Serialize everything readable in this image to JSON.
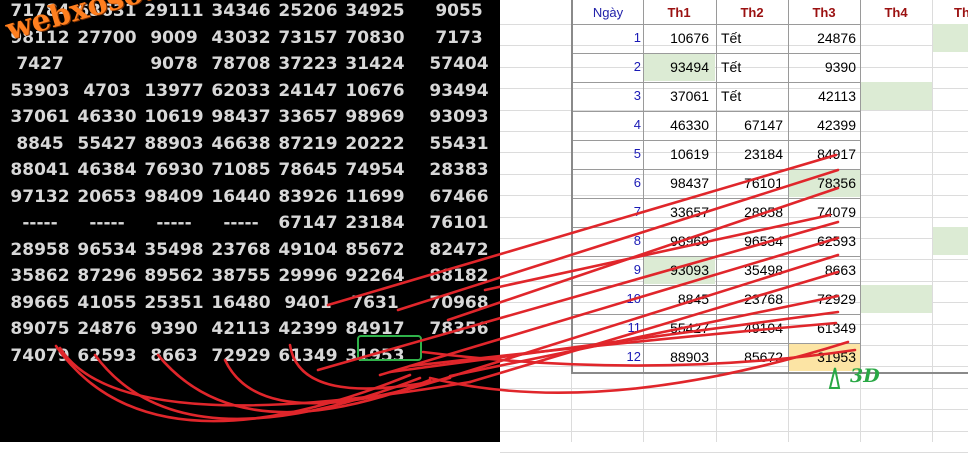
{
  "watermark": "webxoso.net",
  "number_grid": {
    "rows": [
      [
        "71784",
        "63631",
        "29111",
        "34346",
        "25206",
        "34925",
        "9055"
      ],
      [
        "98112",
        "27700",
        "9009",
        "43032",
        "73157",
        "70830",
        "7173"
      ],
      [
        "7427",
        "",
        "9078",
        "78708",
        "37223",
        "31424",
        "57404"
      ],
      [
        "53903",
        "4703",
        "13977",
        "62033",
        "24147",
        "10676",
        "93494"
      ],
      [
        "37061",
        "46330",
        "10619",
        "98437",
        "33657",
        "98969",
        "93093"
      ],
      [
        "8845",
        "55427",
        "88903",
        "46638",
        "87219",
        "20222",
        "55431"
      ],
      [
        "88041",
        "46384",
        "76930",
        "71085",
        "78645",
        "74954",
        "28383"
      ],
      [
        "97132",
        "20653",
        "98409",
        "16440",
        "83926",
        "11699",
        "67466"
      ],
      [
        "-----",
        "-----",
        "-----",
        "-----",
        "67147",
        "23184",
        "76101"
      ],
      [
        "28958",
        "96534",
        "35498",
        "23768",
        "49104",
        "85672",
        "82472"
      ],
      [
        "35862",
        "87296",
        "89562",
        "38755",
        "29996",
        "92264",
        "88182"
      ],
      [
        "89665",
        "41055",
        "25351",
        "16480",
        "9401",
        "7631",
        "70968"
      ],
      [
        "89075",
        "24876",
        "9390",
        "42113",
        "42399",
        "84917",
        "78356"
      ],
      [
        "74079",
        "62593",
        "8663",
        "72929",
        "61349",
        "31953",
        ""
      ]
    ]
  },
  "spreadsheet": {
    "headers": {
      "day": "Ngày",
      "th1": "Th1",
      "th2": "Th2",
      "th3": "Th3",
      "th4": "Th4",
      "th5": "Th"
    },
    "rows": [
      {
        "idx": "1",
        "th1": "10676",
        "th2": "Tết",
        "th3": "24876"
      },
      {
        "idx": "2",
        "th1": "93494",
        "th2": "Tết",
        "th3": "9390"
      },
      {
        "idx": "3",
        "th1": "37061",
        "th2": "Tết",
        "th3": "42113"
      },
      {
        "idx": "4",
        "th1": "46330",
        "th2": "67147",
        "th3": "42399"
      },
      {
        "idx": "5",
        "th1": "10619",
        "th2": "23184",
        "th3": "84917"
      },
      {
        "idx": "6",
        "th1": "98437",
        "th2": "76101",
        "th3": "78356"
      },
      {
        "idx": "7",
        "th1": "33657",
        "th2": "28958",
        "th3": "74079"
      },
      {
        "idx": "8",
        "th1": "98969",
        "th2": "96534",
        "th3": "62593"
      },
      {
        "idx": "9",
        "th1": "93093",
        "th2": "35498",
        "th3": "8663"
      },
      {
        "idx": "10",
        "th1": "8845",
        "th2": "23768",
        "th3": "72929"
      },
      {
        "idx": "11",
        "th1": "55427",
        "th2": "49104",
        "th3": "61349"
      },
      {
        "idx": "12",
        "th1": "88903",
        "th2": "85672",
        "th3": "31953"
      }
    ]
  },
  "annotation_label": "3D",
  "colors": {
    "arrow": "#e0262b",
    "highlight": "#2fb24a",
    "cell_green": "#dcebd4",
    "cell_yellow": "#fce4a4"
  }
}
